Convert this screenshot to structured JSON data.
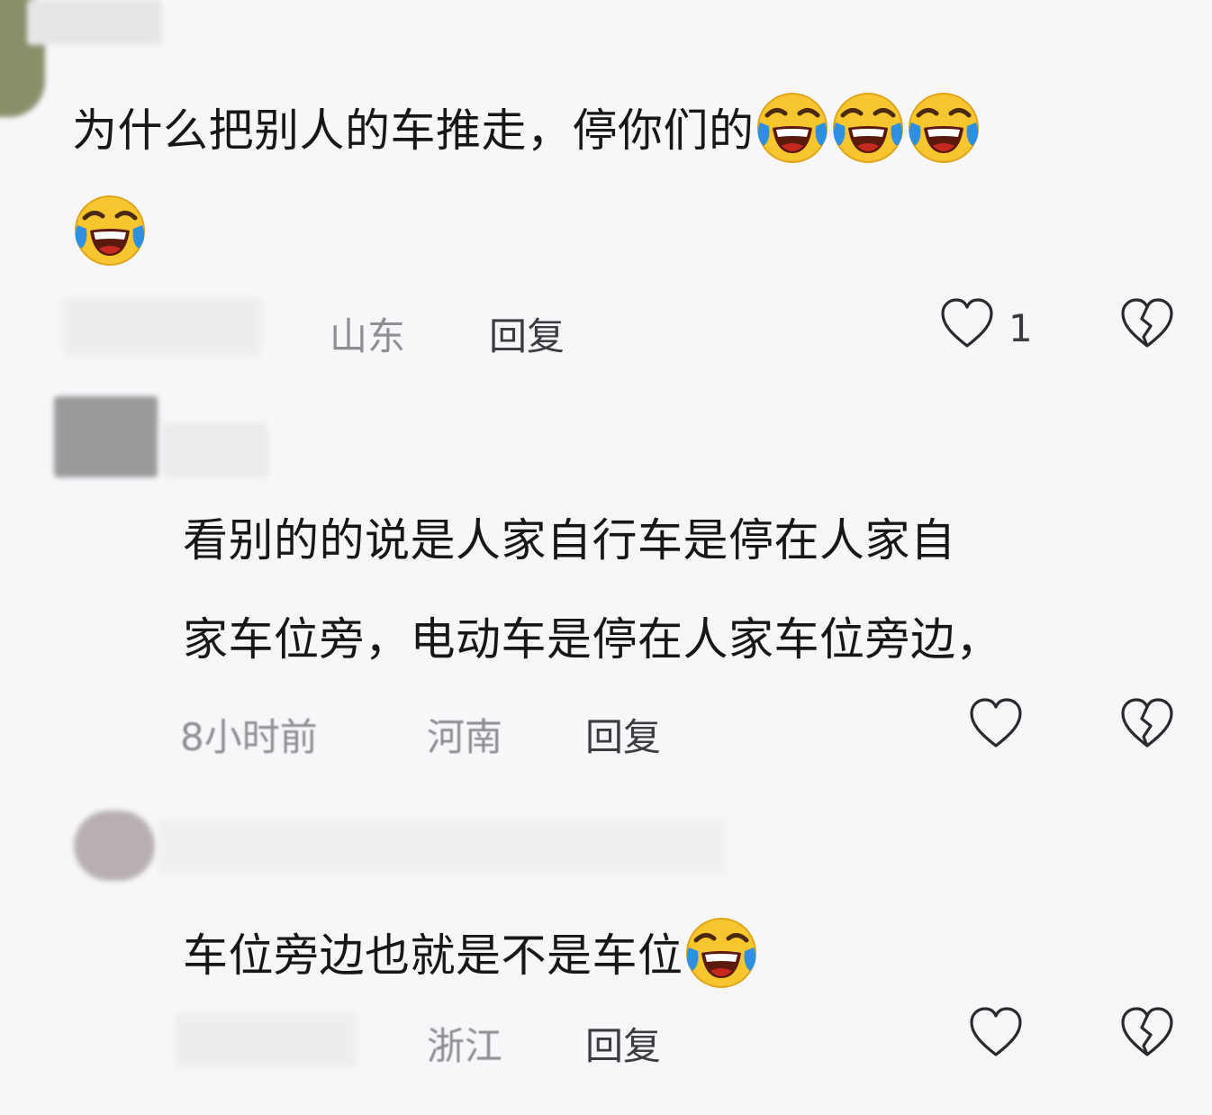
{
  "comments": [
    {
      "text": "为什么把别人的车推走，停你们的",
      "emoji_count": 4,
      "region": "山东",
      "reply_label": "回复",
      "likes": "1"
    },
    {
      "text_lines": [
        "看别的的说是人家自行车是停在人家自",
        "家车位旁，电动车是停在人家车位旁边，"
      ],
      "time": "8小时前",
      "region": "河南",
      "reply_label": "回复",
      "likes": ""
    },
    {
      "text": "车位旁边也就是不是车位",
      "emoji_count": 1,
      "region": "浙江",
      "reply_label": "回复",
      "likes": ""
    }
  ],
  "icons": {
    "emoji": "laughing-crying-emoji",
    "like": "heart-outline-icon",
    "dislike": "broken-heart-icon"
  },
  "colors": {
    "background": "#f7f7f9",
    "emoji_face": "#f7c52e",
    "tears": "#2f8fe0",
    "mouth": "#c62a1e"
  }
}
